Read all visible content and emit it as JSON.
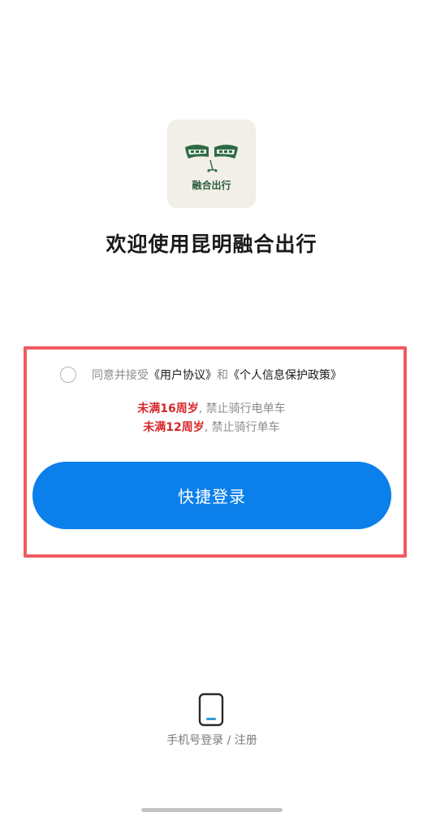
{
  "logo": {
    "icon": "tram-wings-scooter-logo",
    "text": "融合出行"
  },
  "welcome_title": "欢迎使用昆明融合出行",
  "agreement": {
    "prefix": "同意并接受",
    "user_agreement": "《用户协议》",
    "conjunction": "和",
    "privacy_policy": "《个人信息保护政策》",
    "checked": false
  },
  "age_notices": [
    {
      "highlight": "未满16周岁",
      "rest": ", 禁止骑行电单车"
    },
    {
      "highlight": "未满12周岁",
      "rest": ", 禁止骑行单车"
    }
  ],
  "quick_login_label": "快捷登录",
  "phone_login_label": "手机号登录 / 注册",
  "colors": {
    "primary": "#0b7fea",
    "warning": "#d6282b",
    "highlight_border": "#ef5b60",
    "logo_green": "#2f5e3e"
  }
}
